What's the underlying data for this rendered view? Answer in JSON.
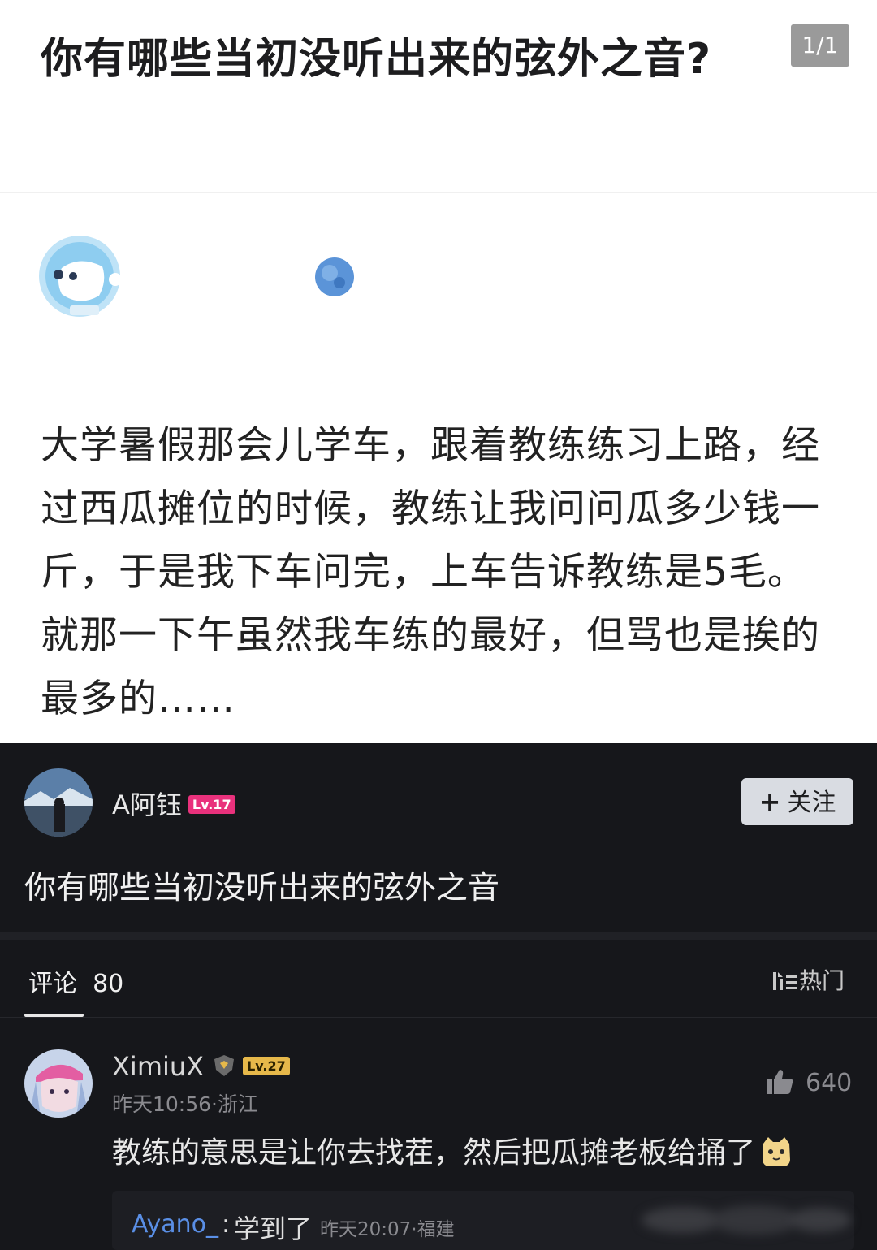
{
  "question": {
    "title": "你有哪些当初没听出来的弦外之音?",
    "page_indicator": "1/1"
  },
  "answer": {
    "text": "大学暑假那会儿学车，跟着教练练习上路，经过西瓜摊位的时候，教练让我问问瓜多少钱一斤，于是我下车问完，上车告诉教练是5毛。就那一下午虽然我车练的最好，但骂也是挨的最多的……"
  },
  "post": {
    "author": "A阿钰",
    "level": "Lv.17",
    "follow_label": "关注",
    "title": "你有哪些当初没听出来的弦外之音"
  },
  "comments_bar": {
    "label": "评论",
    "count": "80",
    "sort_label": "热门"
  },
  "comment": {
    "user": "XimiuX",
    "level": "Lv.27",
    "meta": "昨天10:56·浙江",
    "likes": "640",
    "text": "教练的意思是让你去找茬，然后把瓜摊老板给捅了"
  },
  "reply": {
    "user": "Ayano_",
    "separator": ":",
    "text": "学到了",
    "meta": "昨天20:07·福建"
  },
  "colors": {
    "level_pink": "#e9317c",
    "level_gold": "#e6b84a",
    "reply_name_blue": "#5a8fe6",
    "dark_bg": "#16171b"
  },
  "icons": [
    "astronaut-avatar-icon",
    "plus-icon",
    "sort-icon",
    "shield-badge-icon",
    "thumb-up-icon",
    "cat-emoji-icon"
  ]
}
